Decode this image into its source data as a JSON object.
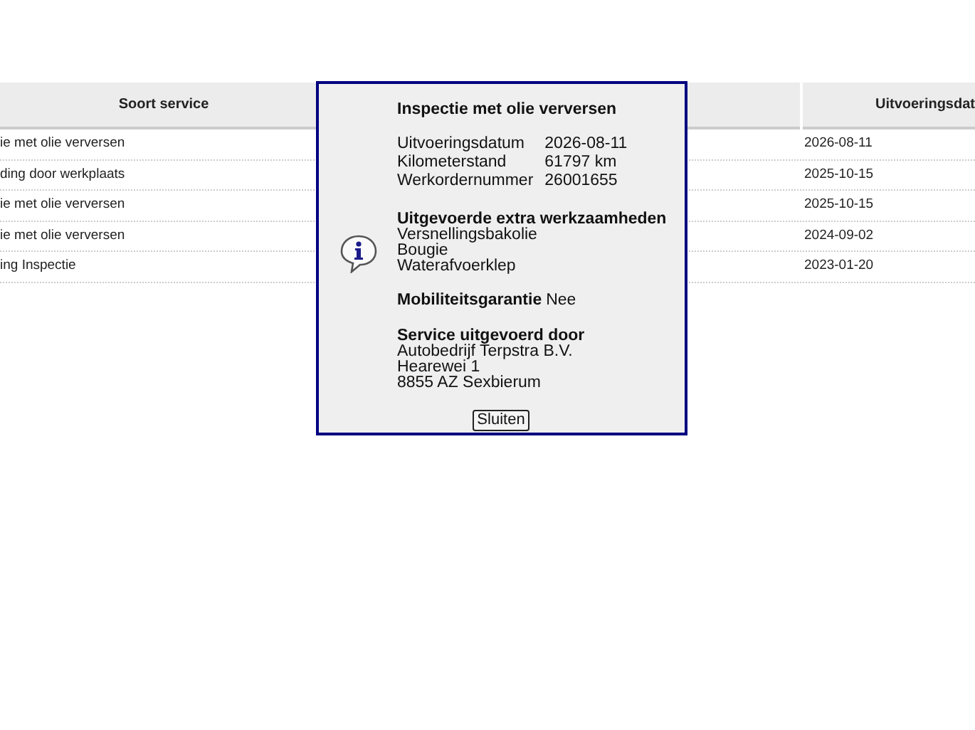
{
  "table": {
    "columns": [
      "Soort service",
      "Uitvoeringsdat"
    ],
    "rows": [
      {
        "service": "ie met olie verversen",
        "date": "2026-08-11"
      },
      {
        "service": "ding door werkplaats",
        "date": "2025-10-15"
      },
      {
        "service": "ie met olie verversen",
        "date": "2025-10-15"
      },
      {
        "service": "ie met olie verversen",
        "date": "2024-09-02"
      },
      {
        "service": "ing Inspectie",
        "date": "2023-01-20"
      }
    ]
  },
  "dialog": {
    "title": "Inspectie met olie verversen",
    "details": [
      {
        "label": "Uitvoeringsdatum",
        "value": "2026-08-11"
      },
      {
        "label": "Kilometerstand",
        "value": "61797 km"
      },
      {
        "label": "Werkordernummer",
        "value": "26001655"
      }
    ],
    "extra_work": {
      "heading": "Uitgevoerde extra werkzaamheden",
      "items": [
        "Versnellingsbakolie",
        "Bougie",
        "Waterafvoerklep"
      ]
    },
    "mobility": {
      "label": "Mobiliteitsgarantie",
      "value": "Nee"
    },
    "performed_by": {
      "heading": "Service uitgevoerd door",
      "lines": [
        "Autobedrijf Terpstra B.V.",
        "Hearewei 1",
        "8855 AZ Sexbierum"
      ]
    },
    "button": "Sluiten"
  }
}
